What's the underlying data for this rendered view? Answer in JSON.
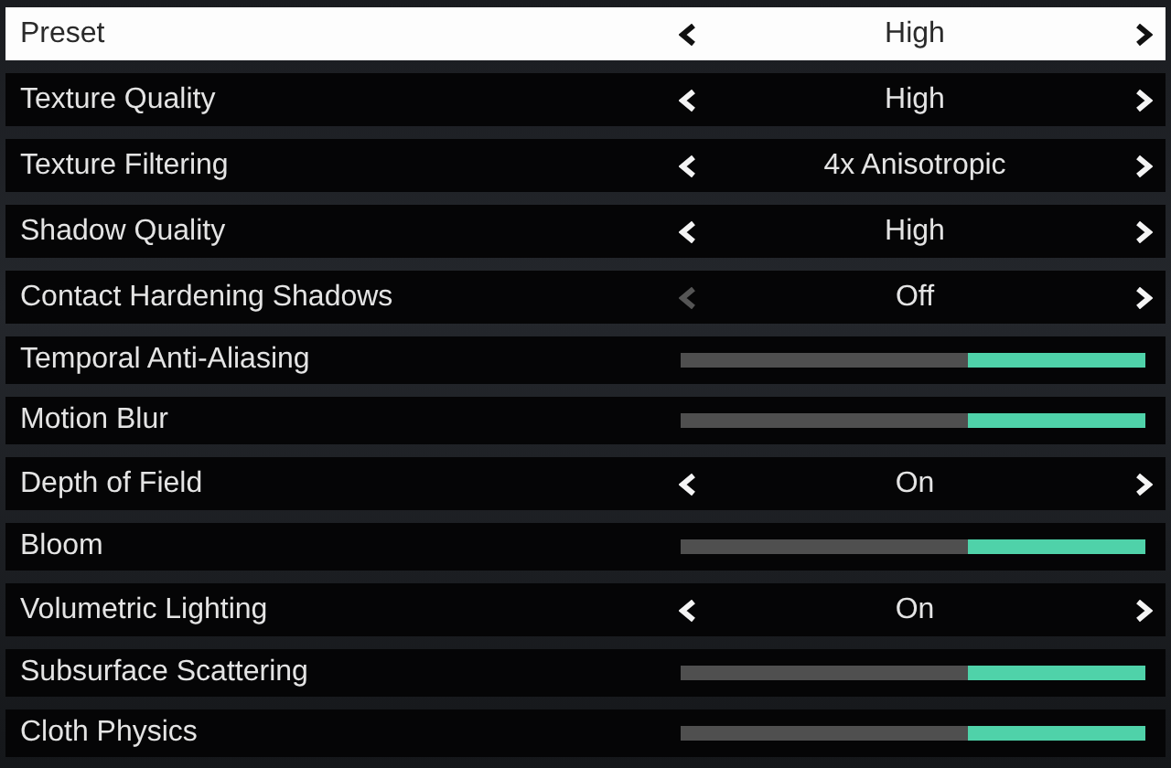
{
  "settings": [
    {
      "kind": "selector",
      "label": "Preset",
      "value": "High",
      "selected": true,
      "prev_disabled": false
    },
    {
      "kind": "selector",
      "label": "Texture Quality",
      "value": "High",
      "selected": false,
      "prev_disabled": false
    },
    {
      "kind": "selector",
      "label": "Texture Filtering",
      "value": "4x Anisotropic",
      "selected": false,
      "prev_disabled": false
    },
    {
      "kind": "selector",
      "label": "Shadow Quality",
      "value": "High",
      "selected": false,
      "prev_disabled": false
    },
    {
      "kind": "selector",
      "label": "Contact Hardening Shadows",
      "value": "Off",
      "selected": false,
      "prev_disabled": true
    },
    {
      "kind": "slider",
      "label": "Temporal Anti-Aliasing",
      "level": 0.38,
      "selected": false
    },
    {
      "kind": "slider",
      "label": "Motion Blur",
      "level": 0.38,
      "selected": false
    },
    {
      "kind": "selector",
      "label": "Depth of Field",
      "value": "On",
      "selected": false,
      "prev_disabled": false
    },
    {
      "kind": "slider",
      "label": "Bloom",
      "level": 0.38,
      "selected": false
    },
    {
      "kind": "selector",
      "label": "Volumetric Lighting",
      "value": "On",
      "selected": false,
      "prev_disabled": false
    },
    {
      "kind": "slider",
      "label": "Subsurface Scattering",
      "level": 0.38,
      "selected": false
    },
    {
      "kind": "slider",
      "label": "Cloth Physics",
      "level": 0.38,
      "selected": false
    }
  ]
}
